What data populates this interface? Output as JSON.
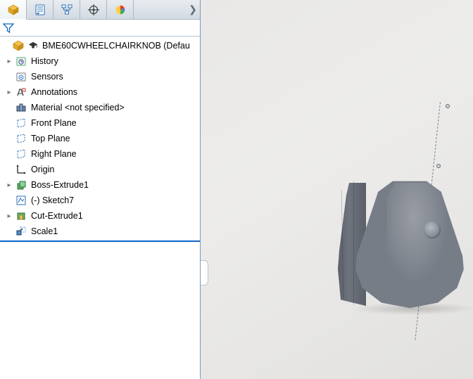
{
  "tabs": [
    {
      "name": "feature-manager-tab",
      "icon": "cube-gold-icon"
    },
    {
      "name": "property-manager-tab",
      "icon": "sheet-lines-icon"
    },
    {
      "name": "configuration-manager-tab",
      "icon": "tree-struct-icon"
    },
    {
      "name": "dimxpert-manager-tab",
      "icon": "crosshair-icon"
    },
    {
      "name": "display-manager-tab",
      "icon": "piecolor-icon"
    }
  ],
  "filter_label": "",
  "root": {
    "label": "BME60CWHEELCHAIRKNOB  (Defau"
  },
  "nodes": [
    {
      "name": "history",
      "icon": "history-icon",
      "label": "History",
      "expandable": true
    },
    {
      "name": "sensors",
      "icon": "sensors-icon",
      "label": "Sensors",
      "expandable": false
    },
    {
      "name": "annotations",
      "icon": "annotations-icon",
      "label": "Annotations",
      "expandable": true
    },
    {
      "name": "material",
      "icon": "material-icon",
      "label": "Material <not specified>",
      "expandable": false
    },
    {
      "name": "front-plane",
      "icon": "plane-icon",
      "label": "Front Plane",
      "expandable": false
    },
    {
      "name": "top-plane",
      "icon": "plane-icon",
      "label": "Top Plane",
      "expandable": false
    },
    {
      "name": "right-plane",
      "icon": "plane-icon",
      "label": "Right Plane",
      "expandable": false
    },
    {
      "name": "origin",
      "icon": "origin-icon",
      "label": "Origin",
      "expandable": false
    },
    {
      "name": "boss-extrude1",
      "icon": "extrude-icon",
      "label": "Boss-Extrude1",
      "expandable": true
    },
    {
      "name": "sketch7",
      "icon": "sketch-icon",
      "label": "(-) Sketch7",
      "expandable": false
    },
    {
      "name": "cut-extrude1",
      "icon": "cutextrude-icon",
      "label": "Cut-Extrude1",
      "expandable": true
    },
    {
      "name": "scale1",
      "icon": "scale-icon",
      "label": "Scale1",
      "expandable": false
    }
  ]
}
